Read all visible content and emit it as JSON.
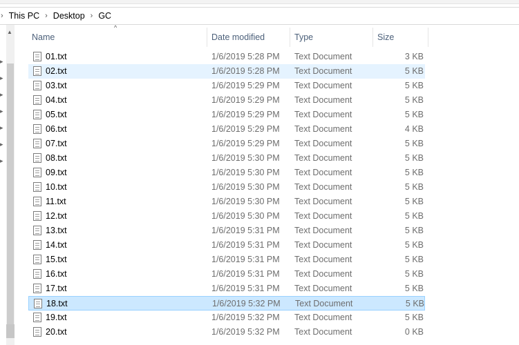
{
  "breadcrumb": {
    "items": [
      "This PC",
      "Desktop",
      "GC"
    ]
  },
  "columns": {
    "name": "Name",
    "date_modified": "Date modified",
    "type": "Type",
    "size": "Size"
  },
  "files": [
    {
      "name": "01.txt",
      "date": "1/6/2019 5:28 PM",
      "type": "Text Document",
      "size": "3 KB"
    },
    {
      "name": "02.txt",
      "date": "1/6/2019 5:28 PM",
      "type": "Text Document",
      "size": "5 KB",
      "state": "hover"
    },
    {
      "name": "03.txt",
      "date": "1/6/2019 5:29 PM",
      "type": "Text Document",
      "size": "5 KB"
    },
    {
      "name": "04.txt",
      "date": "1/6/2019 5:29 PM",
      "type": "Text Document",
      "size": "5 KB"
    },
    {
      "name": "05.txt",
      "date": "1/6/2019 5:29 PM",
      "type": "Text Document",
      "size": "5 KB"
    },
    {
      "name": "06.txt",
      "date": "1/6/2019 5:29 PM",
      "type": "Text Document",
      "size": "4 KB"
    },
    {
      "name": "07.txt",
      "date": "1/6/2019 5:29 PM",
      "type": "Text Document",
      "size": "5 KB"
    },
    {
      "name": "08.txt",
      "date": "1/6/2019 5:30 PM",
      "type": "Text Document",
      "size": "5 KB"
    },
    {
      "name": "09.txt",
      "date": "1/6/2019 5:30 PM",
      "type": "Text Document",
      "size": "5 KB"
    },
    {
      "name": "10.txt",
      "date": "1/6/2019 5:30 PM",
      "type": "Text Document",
      "size": "5 KB"
    },
    {
      "name": "11.txt",
      "date": "1/6/2019 5:30 PM",
      "type": "Text Document",
      "size": "5 KB"
    },
    {
      "name": "12.txt",
      "date": "1/6/2019 5:30 PM",
      "type": "Text Document",
      "size": "5 KB"
    },
    {
      "name": "13.txt",
      "date": "1/6/2019 5:31 PM",
      "type": "Text Document",
      "size": "5 KB"
    },
    {
      "name": "14.txt",
      "date": "1/6/2019 5:31 PM",
      "type": "Text Document",
      "size": "5 KB"
    },
    {
      "name": "15.txt",
      "date": "1/6/2019 5:31 PM",
      "type": "Text Document",
      "size": "5 KB"
    },
    {
      "name": "16.txt",
      "date": "1/6/2019 5:31 PM",
      "type": "Text Document",
      "size": "5 KB"
    },
    {
      "name": "17.txt",
      "date": "1/6/2019 5:31 PM",
      "type": "Text Document",
      "size": "5 KB"
    },
    {
      "name": "18.txt",
      "date": "1/6/2019 5:32 PM",
      "type": "Text Document",
      "size": "5 KB",
      "state": "selected"
    },
    {
      "name": "19.txt",
      "date": "1/6/2019 5:32 PM",
      "type": "Text Document",
      "size": "5 KB"
    },
    {
      "name": "20.txt",
      "date": "1/6/2019 5:32 PM",
      "type": "Text Document",
      "size": "0 KB"
    }
  ],
  "colors": {
    "hover_row": "#e5f3ff",
    "selected_row": "#cce8ff",
    "selected_border": "#99d1ff",
    "header_text": "#4c607a"
  }
}
